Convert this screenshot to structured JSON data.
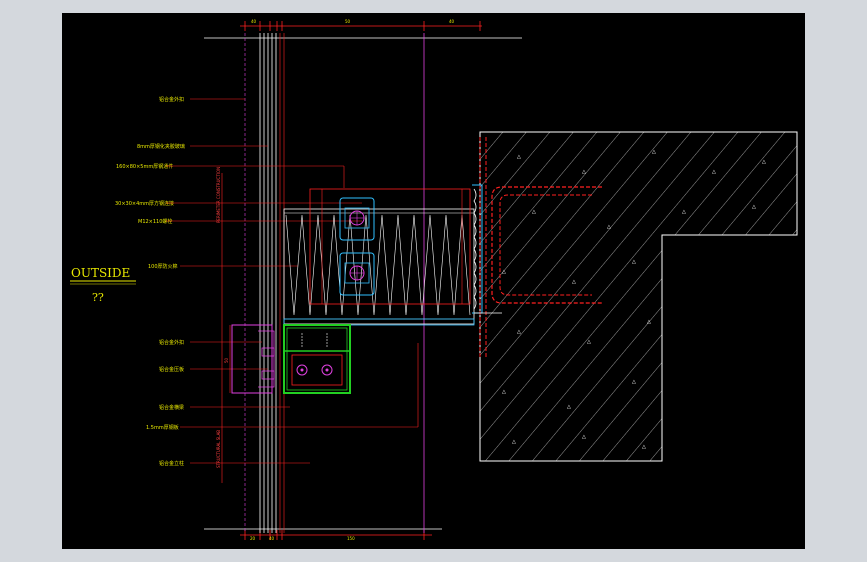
{
  "drawing": {
    "outside_label": "OUTSIDE",
    "outside_sub": "??",
    "callouts": [
      "铝合金外扣",
      "8mm厚钢化夹胶玻璃",
      "160×80×5mm厚钢通件",
      "30×30×4mm厚方钢连接",
      "M12×110螺栓",
      "100厚防火棉",
      "铝合金外扣",
      "铝合金压板",
      "铝合金横梁",
      "1.5mm厚钢板",
      "铝合金立柱"
    ],
    "dims_top": [
      "40",
      "50",
      "40"
    ],
    "dims_bottom": [
      "20",
      "40",
      "150"
    ],
    "dim_vertical": "50",
    "dim_side": "50",
    "vertical_note_upper": "PERIMETER CONSTRUCTION",
    "vertical_note_lower": "STRUCTURAL SLAB"
  },
  "colors": {
    "canvas": "#000000",
    "frame": "#d4d8dd",
    "dim_line": "#ff2020",
    "glass": "#ffffff",
    "green_profile": "#22d022",
    "magenta_profile": "#e040e0",
    "cyan_bracket": "#30c0ff",
    "concrete": "#ffffff",
    "text": "#e8e800"
  }
}
